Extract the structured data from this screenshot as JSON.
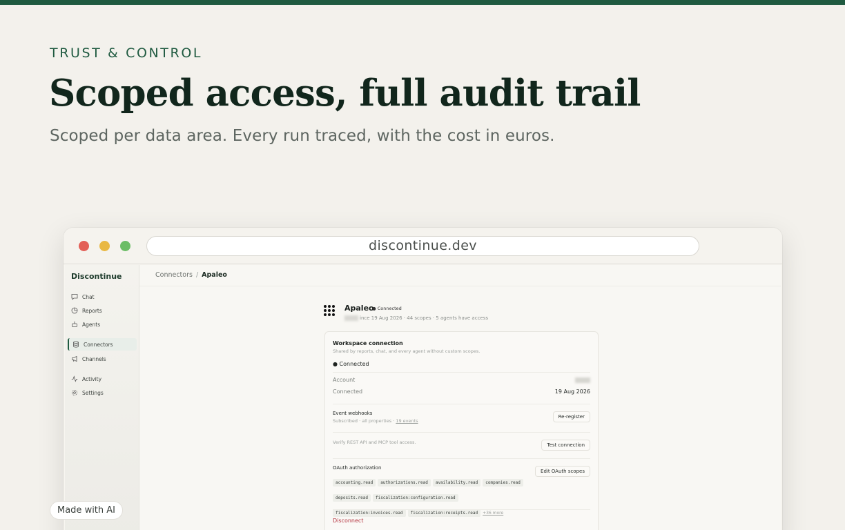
{
  "hero": {
    "eyebrow": "TRUST & CONTROL",
    "title": "Scoped access, full audit trail",
    "subtitle": "Scoped per data area. Every run traced, with the cost in euros."
  },
  "browser": {
    "url": "discontinue.dev"
  },
  "app": {
    "brand": "Discontinue",
    "nav": [
      {
        "label": "Chat",
        "icon": "chat-icon"
      },
      {
        "label": "Reports",
        "icon": "pie-chart-icon"
      },
      {
        "label": "Agents",
        "icon": "robot-icon"
      },
      {
        "label": "Connectors",
        "icon": "database-icon",
        "active": true
      },
      {
        "label": "Channels",
        "icon": "megaphone-icon"
      },
      {
        "label": "Activity",
        "icon": "activity-icon"
      },
      {
        "label": "Settings",
        "icon": "gear-icon"
      }
    ],
    "breadcrumb": {
      "parent": "Connectors",
      "separator": "/",
      "current": "Apaleo"
    },
    "connector": {
      "name": "Apaleo",
      "status": "Connected",
      "meta": "ince 19 Aug 2026 · 44 scopes · 5 agents have access"
    },
    "card": {
      "title": "Workspace connection",
      "subtitle": "Shared by reports, chat, and every agent without custom scopes.",
      "status": "Connected",
      "account_label": "Account",
      "connected_label": "Connected",
      "connected_value": "19 Aug 2026",
      "webhooks_title": "Event webhooks",
      "webhooks_sub": "Subscribed · all properties ·",
      "webhooks_link": "19 events",
      "reregister": "Re-register",
      "verify_text": "Verify REST API and MCP tool access.",
      "test_connection": "Test connection",
      "oauth_title": "OAuth authorization",
      "edit_scopes": "Edit OAuth scopes",
      "scopes": [
        "accounting.read",
        "authorizations.read",
        "availability.read",
        "companies.read",
        "deposits.read",
        "fiscalization:configuration.read",
        "fiscalization:invoices.read",
        "fiscalization:receipts.read"
      ],
      "more_scopes": "+36 more",
      "disconnect": "Disconnect"
    }
  },
  "badge": {
    "label": "Made with AI"
  },
  "colors": {
    "accent": "#1f5a40",
    "danger": "#b4333f",
    "background": "#f3f1ec"
  }
}
